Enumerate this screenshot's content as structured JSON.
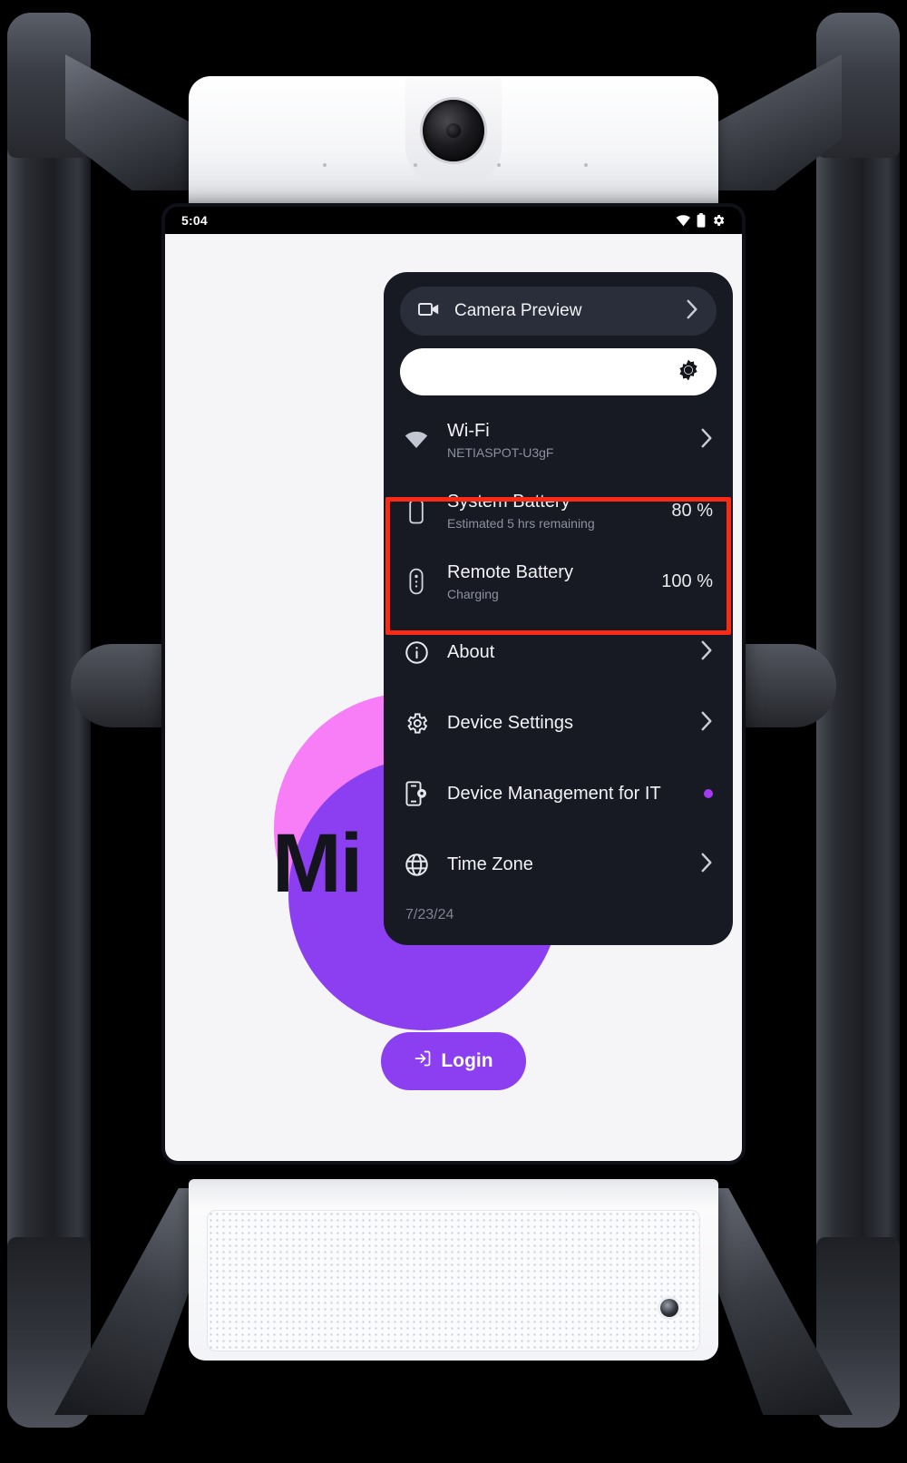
{
  "device": {
    "type": "telepresence-robot",
    "camera_icon": "camera-lens",
    "speaker_icon": "speaker-grille"
  },
  "statusbar": {
    "time": "5:04",
    "icons": [
      "wifi-icon",
      "battery-icon",
      "gear-icon"
    ]
  },
  "screen": {
    "brand_title": "Mi",
    "login_label": "Login",
    "login_icon": "login-arrow-icon",
    "accent_purple": "#8b3ff0",
    "accent_pink": "#f77ef7",
    "background": "#f5f5f7"
  },
  "panel": {
    "background": "#171a23",
    "camera_preview": {
      "label": "Camera Preview",
      "icon": "video-camera-icon",
      "chevron": "chevron-right-icon"
    },
    "brightness": {
      "icon": "brightness-icon",
      "value": "100"
    },
    "items": [
      {
        "id": "wifi",
        "icon": "wifi-icon",
        "title": "Wi-Fi",
        "subtitle": "NETIASPOT-U3gF",
        "value": "",
        "accessory": "chevron"
      },
      {
        "id": "system-battery",
        "icon": "battery-icon",
        "title": "System Battery",
        "subtitle": "Estimated 5 hrs remaining",
        "value": "80 %",
        "accessory": "value"
      },
      {
        "id": "remote-battery",
        "icon": "remote-control-icon",
        "title": "Remote Battery",
        "subtitle": "Charging",
        "value": "100 %",
        "accessory": "value"
      },
      {
        "id": "about",
        "icon": "info-icon",
        "title": "About",
        "subtitle": "",
        "value": "",
        "accessory": "chevron"
      },
      {
        "id": "device-settings",
        "icon": "gear-icon",
        "title": "Device Settings",
        "subtitle": "",
        "value": "",
        "accessory": "chevron"
      },
      {
        "id": "device-management",
        "icon": "device-management-icon",
        "title": "Device Management for IT",
        "subtitle": "",
        "value": "",
        "accessory": "dot"
      },
      {
        "id": "time-zone",
        "icon": "globe-icon",
        "title": "Time Zone",
        "subtitle": "",
        "value": "",
        "accessory": "chevron"
      }
    ],
    "date": "7/23/24"
  },
  "annotation": {
    "highlight_color": "#fa2a16",
    "targets": [
      "system-battery",
      "remote-battery"
    ]
  }
}
